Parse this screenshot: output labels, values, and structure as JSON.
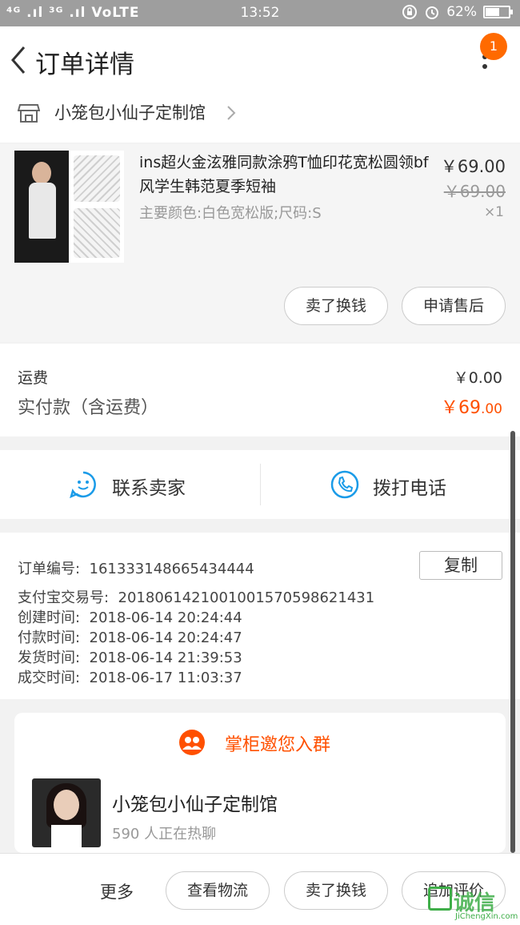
{
  "status_bar": {
    "left": "⁴ᴳ .ıl ³ᴳ .ıl VoLTE",
    "time": "13:52",
    "battery": "62%",
    "battery_level": 0.62
  },
  "header": {
    "title": "订单详情",
    "badge_count": "1"
  },
  "shop": {
    "name": "小笼包小仙子定制馆"
  },
  "product": {
    "title": "ins超火金泫雅同款涂鸦T恤印花宽松圆领bf风学生韩范夏季短袖",
    "sku": "主要颜色:白色宽松版;尺码:S",
    "price": "￥69.00",
    "original_price": "￥69.00",
    "quantity": "×1",
    "actions": {
      "sell": "卖了换钱",
      "after_sale": "申请售后"
    }
  },
  "fees": {
    "shipping_label": "运费",
    "shipping_value": "￥0.00",
    "paid_label": "实付款（含运费）",
    "paid_main": "￥69",
    "paid_decimal": ".00"
  },
  "contact": {
    "seller": "联系卖家",
    "call": "拨打电话"
  },
  "order_info": {
    "order_no_label": "订单编号:",
    "order_no": "161333148665434444",
    "copy_label": "复制",
    "alipay_label": "支付宝交易号:",
    "alipay_no": "2018061421001001570598621431",
    "created_label": "创建时间:",
    "created": "2018-06-14 20:24:44",
    "paid_label": "付款时间:",
    "paid": "2018-06-14 20:24:47",
    "shipped_label": "发货时间:",
    "shipped": "2018-06-14 21:39:53",
    "completed_label": "成交时间:",
    "completed": "2018-06-17 11:03:37"
  },
  "group": {
    "heading": "掌柜邀您入群",
    "name": "小笼包小仙子定制馆",
    "count": "590 人正在热聊"
  },
  "bottom_bar": {
    "more": "更多",
    "logistics": "查看物流",
    "sell": "卖了换钱",
    "review": "追加评价"
  },
  "watermark": {
    "text": "诚信",
    "sub": "JiChengXin.com"
  },
  "colors": {
    "accent": "#ff5000",
    "link_blue": "#1a9be8",
    "badge": "#ff6a00"
  }
}
